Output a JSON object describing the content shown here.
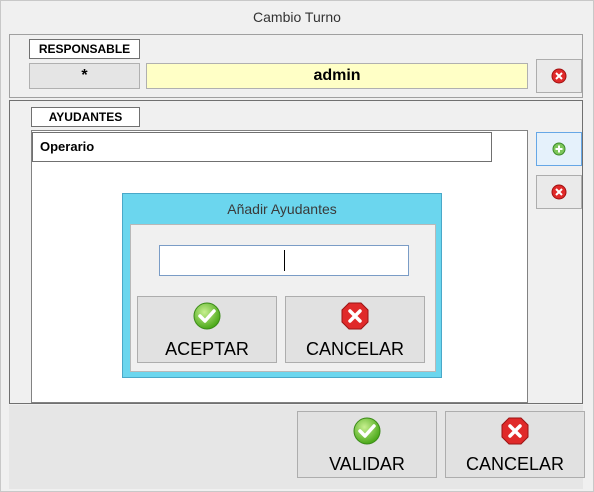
{
  "window": {
    "title": "Cambio Turno"
  },
  "responsable": {
    "caption": "RESPONSABLE",
    "code": "*",
    "name": "admin"
  },
  "ayudantes": {
    "caption": "AYUDANTES",
    "columns": [
      "Operario"
    ]
  },
  "dialog": {
    "title": "Añadir Ayudantes",
    "input_value": "",
    "accept_label": "ACEPTAR",
    "cancel_label": "CANCELAR"
  },
  "footer": {
    "validate_label": "VALIDAR",
    "cancel_label": "CANCELAR"
  },
  "colors": {
    "dialog_bg": "#6bd6ee",
    "highlight_field": "#ffffc6",
    "ok_green": "#6cc531",
    "cancel_red": "#e02a2a"
  }
}
